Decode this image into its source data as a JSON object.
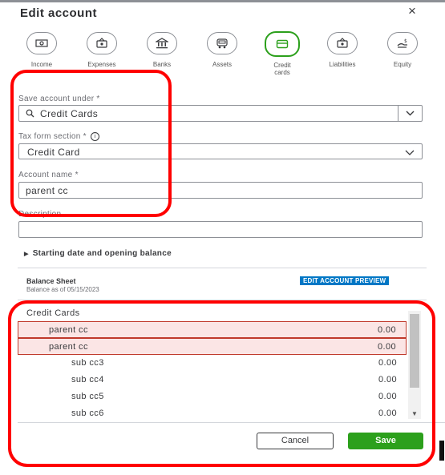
{
  "dialog": {
    "title": "Edit account",
    "close_label": "×"
  },
  "account_types": [
    {
      "label": "Income",
      "icon": "money-icon"
    },
    {
      "label": "Expenses",
      "icon": "money-bag-icon"
    },
    {
      "label": "Banks",
      "icon": "bank-icon"
    },
    {
      "label": "Assets",
      "icon": "vehicle-icon"
    },
    {
      "label": "Credit cards",
      "icon": "credit-card-icon",
      "active": true
    },
    {
      "label": "Liabilities",
      "icon": "liability-icon"
    },
    {
      "label": "Equity",
      "icon": "equity-icon"
    }
  ],
  "form": {
    "save_under_label": "Save account under *",
    "save_under_value": "Credit Cards",
    "tax_form_label": "Tax form section *",
    "tax_form_value": "Credit Card",
    "account_name_label": "Account name *",
    "account_name_value": "parent cc",
    "description_label": "Description",
    "description_value": ""
  },
  "starting_balance_link": "Starting date and opening balance",
  "balance_sheet": {
    "title": "Balance Sheet",
    "subtitle": "Balance as of 05/15/2023",
    "edit_preview_label": "EDIT ACCOUNT PREVIEW",
    "header": "Credit Cards",
    "rows": [
      {
        "name": "parent cc",
        "amount": "0.00"
      },
      {
        "name": "parent cc",
        "amount": "0.00"
      },
      {
        "name": "sub cc3",
        "amount": "0.00"
      },
      {
        "name": "sub cc4",
        "amount": "0.00"
      },
      {
        "name": "sub cc5",
        "amount": "0.00"
      },
      {
        "name": "sub cc6",
        "amount": "0.00"
      }
    ]
  },
  "buttons": {
    "cancel": "Cancel",
    "save": "Save"
  },
  "colors": {
    "accent": "#2ca01c",
    "annotation": "#ff0000",
    "preview_badge": "#0077c5"
  }
}
